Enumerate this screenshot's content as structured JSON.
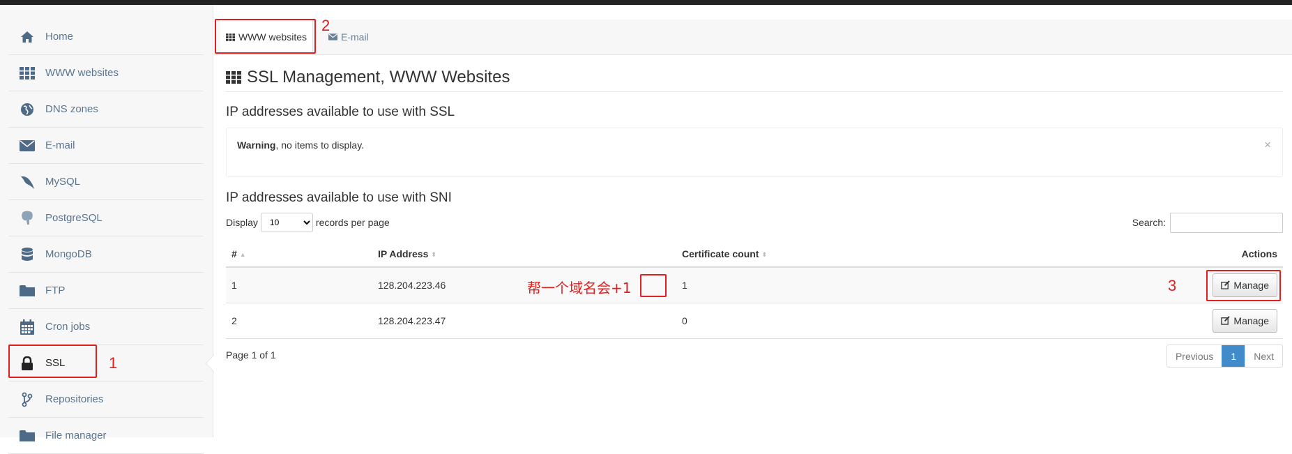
{
  "sidebar": {
    "items": [
      {
        "label": "Home",
        "icon": "home-icon"
      },
      {
        "label": "WWW websites",
        "icon": "grid-icon"
      },
      {
        "label": "DNS zones",
        "icon": "globe-icon"
      },
      {
        "label": "E-mail",
        "icon": "envelope-icon"
      },
      {
        "label": "MySQL",
        "icon": "dolphin-icon"
      },
      {
        "label": "PostgreSQL",
        "icon": "elephant-icon"
      },
      {
        "label": "MongoDB",
        "icon": "database-icon"
      },
      {
        "label": "FTP",
        "icon": "folder-icon"
      },
      {
        "label": "Cron jobs",
        "icon": "calendar-icon"
      },
      {
        "label": "SSL",
        "icon": "lock-icon",
        "active": true
      },
      {
        "label": "Repositories",
        "icon": "branch-icon"
      },
      {
        "label": "File manager",
        "icon": "folder-icon"
      }
    ]
  },
  "tabs": [
    {
      "label": "WWW websites",
      "icon": "grid-icon",
      "active": true
    },
    {
      "label": "E-mail",
      "icon": "envelope-icon"
    }
  ],
  "main": {
    "title": "SSL Management, WWW Websites",
    "ssl_heading": "IP addresses available to use with SSL",
    "alert": {
      "strong": "Warning",
      "text": ", no items to display.",
      "close": "×"
    },
    "sni_heading": "IP addresses available to use with SNI",
    "display_prefix": "Display",
    "display_value": "10",
    "display_suffix": "records per page",
    "search_label": "Search:",
    "table": {
      "columns": [
        "#",
        "IP Address",
        "Certificate count",
        "Actions"
      ],
      "rows": [
        {
          "num": "1",
          "ip": "128.204.223.46",
          "count": "1",
          "action": "Manage"
        },
        {
          "num": "2",
          "ip": "128.204.223.47",
          "count": "0",
          "action": "Manage"
        }
      ]
    },
    "page_info": "Page 1 of 1",
    "pager": {
      "previous": "Previous",
      "current": "1",
      "next": "Next"
    }
  },
  "annotations": {
    "n1": "1",
    "n2": "2",
    "n3": "3",
    "note": "帮一个域名会+1"
  },
  "colors": {
    "annotation": "#e02020",
    "pager_active": "#428bca",
    "sidebar_text": "#5a7590"
  }
}
